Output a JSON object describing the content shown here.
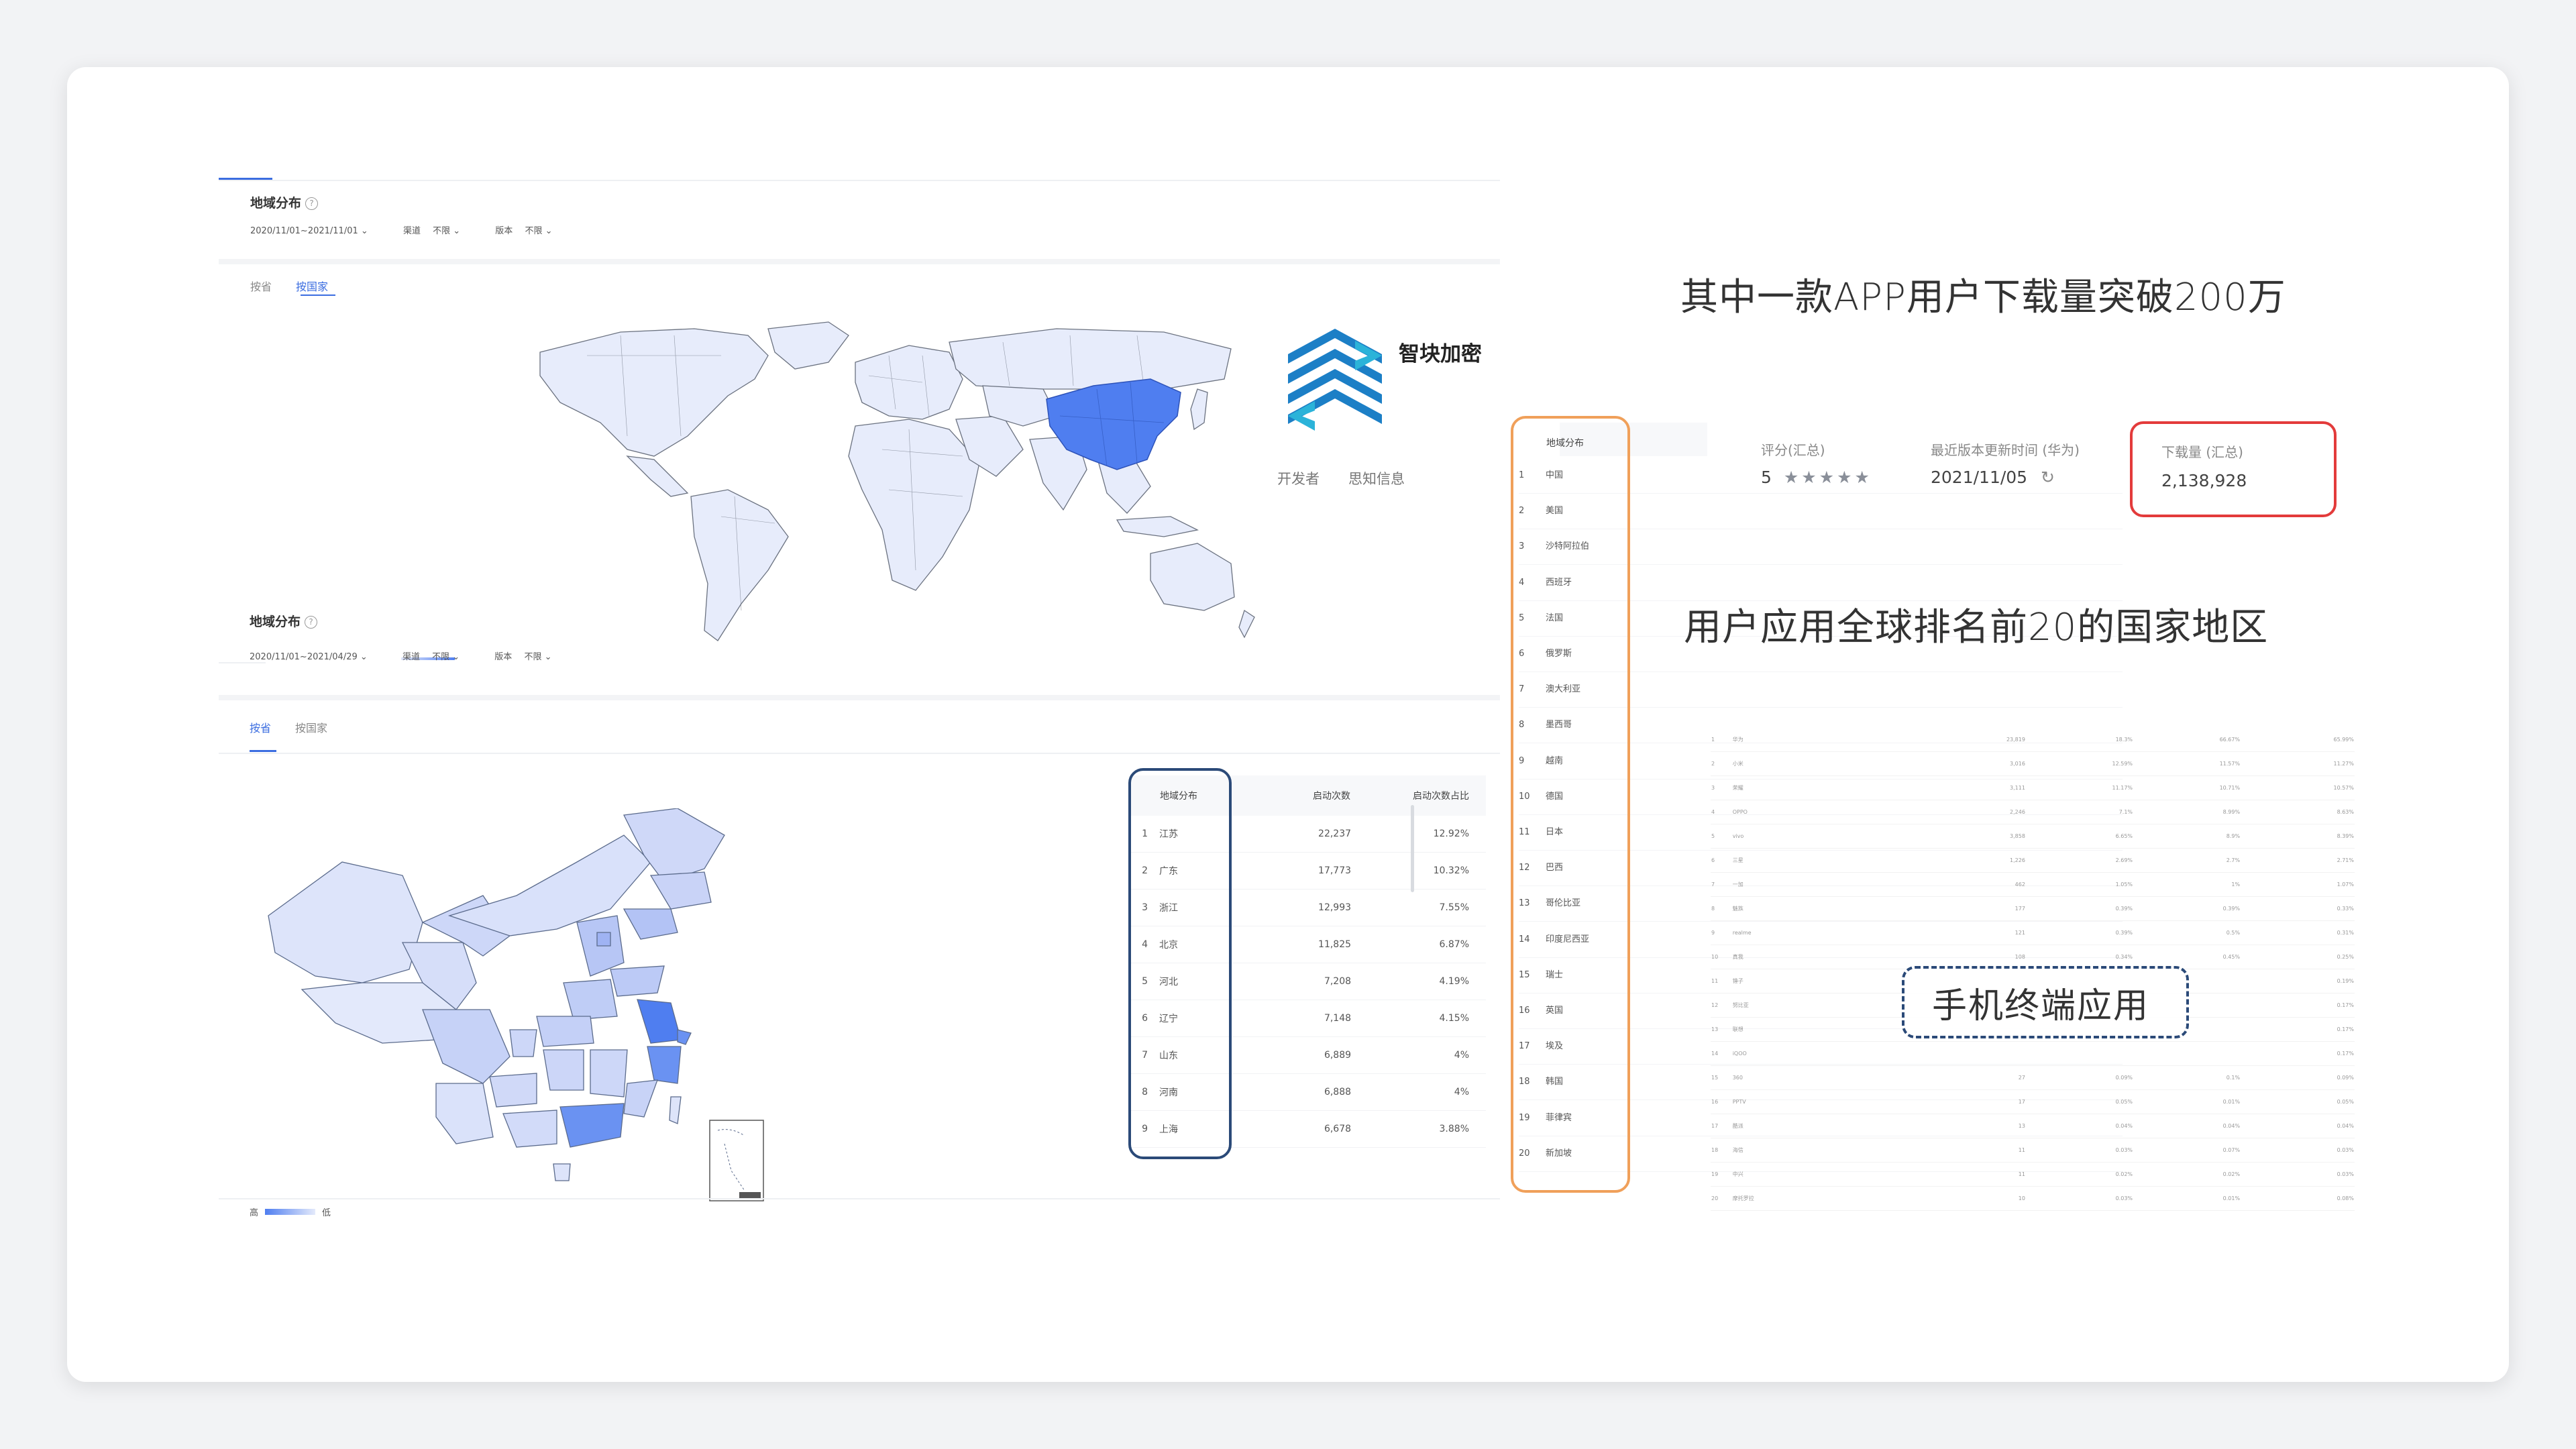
{
  "logo": {
    "name": "智块加密",
    "developer_label": "开发者",
    "developer_value": "思知信息"
  },
  "panel_top": {
    "title": "地域分布",
    "date_range": "2020/11/01~2021/11/01",
    "channel_label": "渠道",
    "channel_value": "不限",
    "version_label": "版本",
    "version_value": "不限",
    "tabs": [
      {
        "label": "按省"
      },
      {
        "label": "按国家"
      }
    ],
    "active_tab": 1
  },
  "panel_bottom": {
    "title": "地域分布",
    "date_range": "2020/11/01~2021/04/29",
    "channel_label": "渠道",
    "channel_value": "不限",
    "version_label": "版本",
    "version_value": "不限",
    "tabs": [
      {
        "label": "按省"
      },
      {
        "label": "按国家"
      }
    ],
    "active_tab": 0,
    "legend_high": "高",
    "legend_low": "低"
  },
  "province_table": {
    "headers": [
      "地域分布",
      "启动次数",
      "启动次数占比"
    ],
    "rows": [
      [
        "1",
        "江苏",
        "22,237",
        "12.92%"
      ],
      [
        "2",
        "广东",
        "17,773",
        "10.32%"
      ],
      [
        "3",
        "浙江",
        "12,993",
        "7.55%"
      ],
      [
        "4",
        "北京",
        "11,825",
        "6.87%"
      ],
      [
        "5",
        "河北",
        "7,208",
        "4.19%"
      ],
      [
        "6",
        "辽宁",
        "7,148",
        "4.15%"
      ],
      [
        "7",
        "山东",
        "6,889",
        "4%"
      ],
      [
        "8",
        "河南",
        "6,888",
        "4%"
      ],
      [
        "9",
        "上海",
        "6,678",
        "3.88%"
      ]
    ]
  },
  "country_list": {
    "header": "地域分布",
    "rows": [
      [
        "1",
        "中国"
      ],
      [
        "2",
        "美国"
      ],
      [
        "3",
        "沙特阿拉伯"
      ],
      [
        "4",
        "西班牙"
      ],
      [
        "5",
        "法国"
      ],
      [
        "6",
        "俄罗斯"
      ],
      [
        "7",
        "澳大利亚"
      ],
      [
        "8",
        "墨西哥"
      ],
      [
        "9",
        "越南"
      ],
      [
        "10",
        "德国"
      ],
      [
        "11",
        "日本"
      ],
      [
        "12",
        "巴西"
      ],
      [
        "13",
        "哥伦比亚"
      ],
      [
        "14",
        "印度尼西亚"
      ],
      [
        "15",
        "瑞士"
      ],
      [
        "16",
        "英国"
      ],
      [
        "17",
        "埃及"
      ],
      [
        "18",
        "韩国"
      ],
      [
        "19",
        "菲律宾"
      ],
      [
        "20",
        "新加坡"
      ]
    ]
  },
  "headline": "其中一款APP用户下载量突破200万",
  "stats": {
    "rating_label": "评分(汇总)",
    "rating_value": "5",
    "update_label": "最近版本更新时间 (华为)",
    "update_value": "2021/11/05",
    "downloads_label": "下载量 (汇总)",
    "downloads_value": "2,138,928"
  },
  "subheadline": "用户应用全球排名前20的国家地区",
  "terminal_label": "手机终端应用",
  "terminal_table": {
    "rows": [
      [
        "1",
        "华为",
        "23,819",
        "18.3%",
        "66.67%",
        "65.99%"
      ],
      [
        "2",
        "小米",
        "3,016",
        "12.59%",
        "11.57%",
        "11.27%"
      ],
      [
        "3",
        "荣耀",
        "3,111",
        "11.17%",
        "10.71%",
        "10.57%"
      ],
      [
        "4",
        "OPPO",
        "2,246",
        "7.1%",
        "8.99%",
        "8.63%"
      ],
      [
        "5",
        "vivo",
        "3,858",
        "6.65%",
        "8.9%",
        "8.39%"
      ],
      [
        "6",
        "三星",
        "1,226",
        "2.69%",
        "2.7%",
        "2.71%"
      ],
      [
        "7",
        "一加",
        "462",
        "1.05%",
        "1%",
        "1.07%"
      ],
      [
        "8",
        "魅族",
        "177",
        "0.39%",
        "0.39%",
        "0.33%"
      ],
      [
        "9",
        "realme",
        "121",
        "0.39%",
        "0.5%",
        "0.31%"
      ],
      [
        "10",
        "真我",
        "108",
        "0.34%",
        "0.45%",
        "0.25%"
      ],
      [
        "11",
        "锤子",
        "",
        "",
        "",
        "0.19%"
      ],
      [
        "12",
        "努比亚",
        "",
        "",
        "",
        "0.17%"
      ],
      [
        "13",
        "联想",
        "",
        "",
        "",
        "0.17%"
      ],
      [
        "14",
        "iQOO",
        "",
        "",
        "",
        "0.17%"
      ],
      [
        "15",
        "360",
        "27",
        "0.09%",
        "0.1%",
        "0.09%"
      ],
      [
        "16",
        "PPTV",
        "17",
        "0.05%",
        "0.01%",
        "0.05%"
      ],
      [
        "17",
        "酷派",
        "13",
        "0.04%",
        "0.04%",
        "0.04%"
      ],
      [
        "18",
        "海信",
        "11",
        "0.03%",
        "0.07%",
        "0.03%"
      ],
      [
        "19",
        "中兴",
        "11",
        "0.02%",
        "0.02%",
        "0.03%"
      ],
      [
        "20",
        "摩托罗拉",
        "10",
        "0.03%",
        "0.01%",
        "0.08%"
      ]
    ]
  },
  "colors": {
    "accent": "#3b6de0",
    "china_highlight": "#4f7ef0",
    "map_fill": "#e7ecfb",
    "orange_outline": "#f0a05a",
    "red_outline": "#e33b3b",
    "navy_outline": "#2b4a78",
    "logo_blue": "#1c7fc6"
  },
  "icons": {
    "help": "question-circle-icon",
    "refresh": "refresh-icon",
    "dropdown": "chevron-down-icon",
    "star": "star-icon"
  }
}
